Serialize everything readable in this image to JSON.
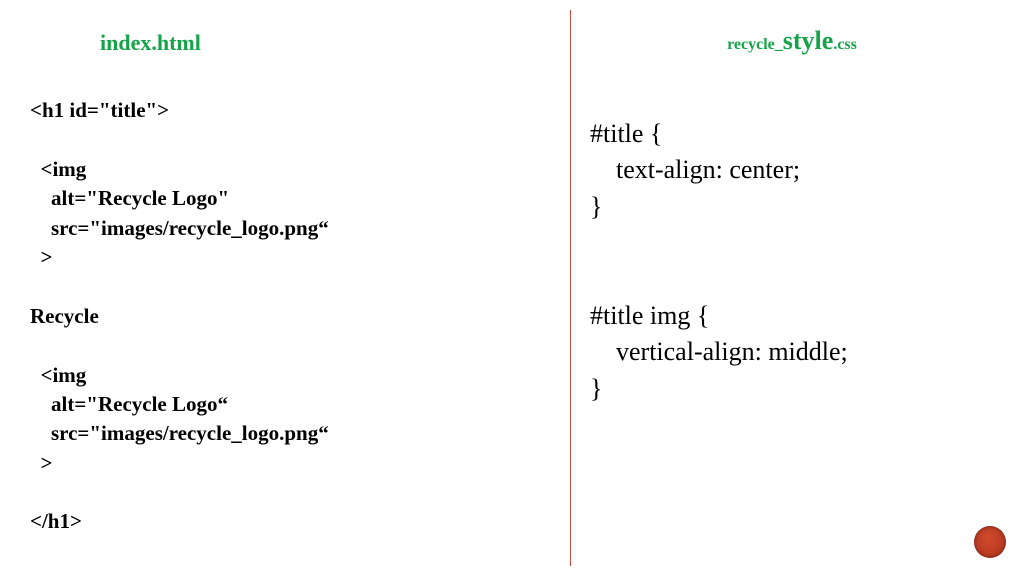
{
  "left": {
    "title": "index.html",
    "code": "<h1 id=\"title\">\n\n  <img\n    alt=\"Recycle Logo\"\n    src=\"images/recycle_logo.png“\n  >\n\nRecycle\n\n  <img\n    alt=\"Recycle Logo“\n    src=\"images/recycle_logo.png“\n  >\n\n</h1>"
  },
  "right": {
    "title_prefix": "recycle_",
    "title_main": "style",
    "title_suffix": ".css",
    "code": "#title {\n    text-align: center;\n}\n\n\n#title img {\n    vertical-align: middle;\n}"
  }
}
